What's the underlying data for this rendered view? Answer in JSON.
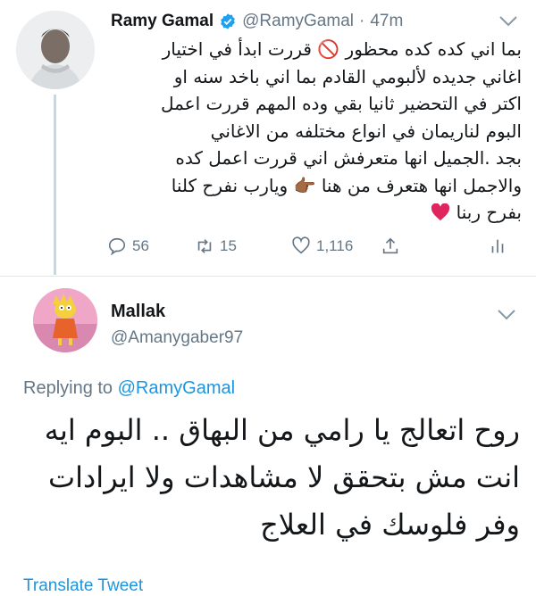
{
  "tweet": {
    "author_name": "Ramy Gamal",
    "handle": "@RamyGamal",
    "separator": "·",
    "time": "47m",
    "text_lines": [
      "بما اني كده كده محظور 🚫 قررت ابدأ في اختيار",
      "اغاني جديده لألبومي القادم بما اني باخد سنه او",
      "اكتر في التحضير ثانيا بقي وده المهم قررت اعمل",
      "البوم لناريمان في انواع مختلفه من الاغاني",
      "بجد .الجميل انها متعرفش اني قررت اعمل كده",
      "والاجمل انها هتعرف من هنا 👉🏾 ويارب نفرح كلنا",
      "بفرح ربنا"
    ],
    "end_emoji": "heart-emoji",
    "actions": {
      "replies": "56",
      "retweets": "15",
      "likes": "1,116"
    },
    "icons": {
      "verified": "verified-badge-icon",
      "more": "chevron-down-icon",
      "reply": "reply-icon",
      "retweet": "retweet-icon",
      "like": "heart-icon",
      "share": "share-icon",
      "analytics": "analytics-icon"
    }
  },
  "reply": {
    "author_name": "Mallak",
    "handle": "@Amanygaber97",
    "replying_prefix": "Replying to",
    "replying_to": "@RamyGamal",
    "text_lines": [
      "روح اتعالج يا رامي من البهاق .. البوم ايه",
      "انت مش بتحقق لا مشاهدات ولا ايرادات",
      "وفر فلوسك في العلاج"
    ],
    "translate_label": "Translate Tweet"
  },
  "colors": {
    "link": "#1b95e0",
    "muted": "#657786",
    "text": "#14171a",
    "divider": "#e1e8ed",
    "heart": "#e0245e"
  }
}
